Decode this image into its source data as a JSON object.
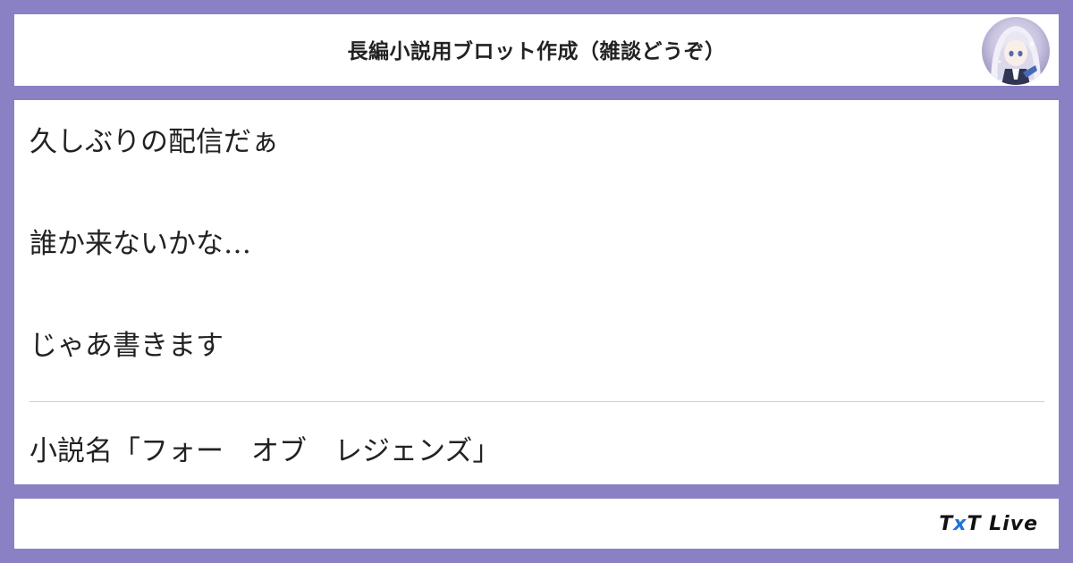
{
  "header": {
    "title": "長編小説用ブロット作成（雑談どうぞ）"
  },
  "messages": [
    {
      "text": "久しぶりの配信だぁ"
    },
    {
      "text": "誰か来ないかな…"
    },
    {
      "text": "じゃあ書きます"
    },
    {
      "text": "小説名「フォー　オブ　レジェンズ」"
    }
  ],
  "footer": {
    "brand_prefix": "T",
    "brand_x": "x",
    "brand_suffix": "T Live"
  },
  "colors": {
    "frame": "#8a80c4",
    "panel": "#ffffff",
    "text": "#222222",
    "brand_accent": "#1e73d8"
  },
  "icons": {
    "avatar": "avatar-anime-girl"
  }
}
